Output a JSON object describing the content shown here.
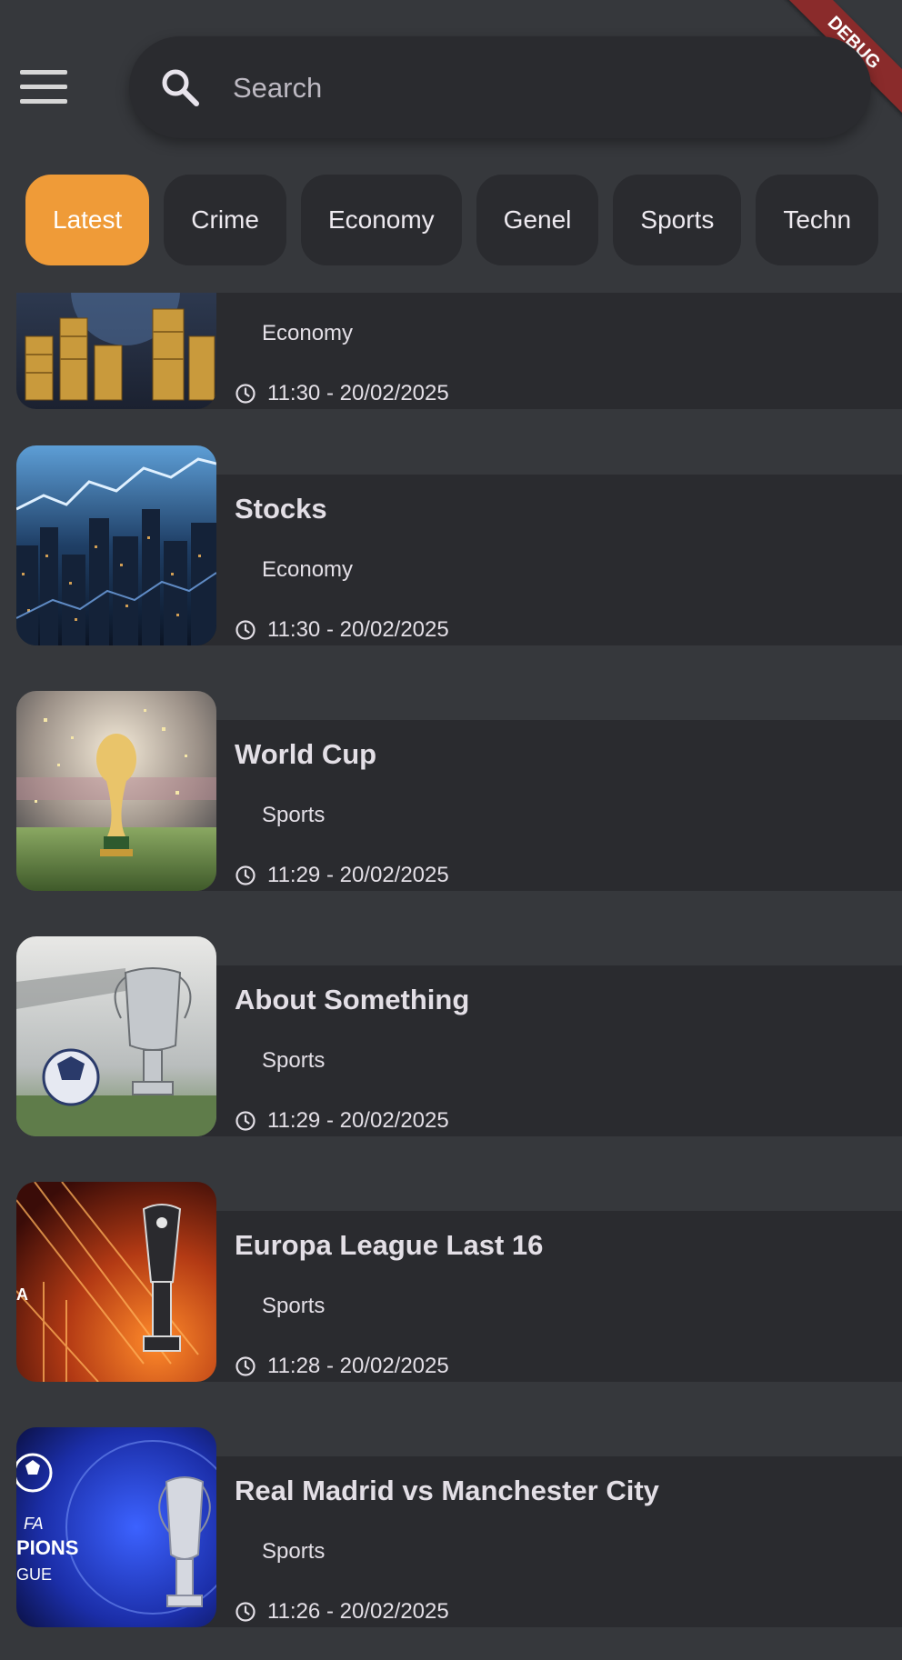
{
  "debug_banner": "DEBUG",
  "search": {
    "placeholder": "Search",
    "value": ""
  },
  "categories": [
    {
      "label": "Latest",
      "active": true
    },
    {
      "label": "Crime",
      "active": false
    },
    {
      "label": "Economy",
      "active": false
    },
    {
      "label": "Genel",
      "active": false
    },
    {
      "label": "Sports",
      "active": false
    },
    {
      "label": "Techn",
      "active": false
    }
  ],
  "news": [
    {
      "title": "",
      "category": "Economy",
      "time": "11:30 - 20/02/2025",
      "thumbnail": "coins-image"
    },
    {
      "title": "Stocks",
      "category": "Economy",
      "time": "11:30 - 20/02/2025",
      "thumbnail": "city-stock-chart-image"
    },
    {
      "title": "World Cup",
      "category": "Sports",
      "time": "11:29 - 20/02/2025",
      "thumbnail": "world-cup-trophy-image"
    },
    {
      "title": "About Something",
      "category": "Sports",
      "time": "11:29 - 20/02/2025",
      "thumbnail": "champions-trophy-ball-image"
    },
    {
      "title": "Europa League Last 16",
      "category": "Sports",
      "time": "11:28 - 20/02/2025",
      "thumbnail": "europa-league-trophy-image"
    },
    {
      "title": "Real Madrid vs Manchester City",
      "category": "Sports",
      "time": "11:26 - 20/02/2025",
      "thumbnail": "champions-league-image"
    }
  ],
  "colors": {
    "background": "#36383c",
    "surface": "#2a2b2f",
    "accent": "#ef9b38",
    "debug": "#8a2b2b"
  }
}
